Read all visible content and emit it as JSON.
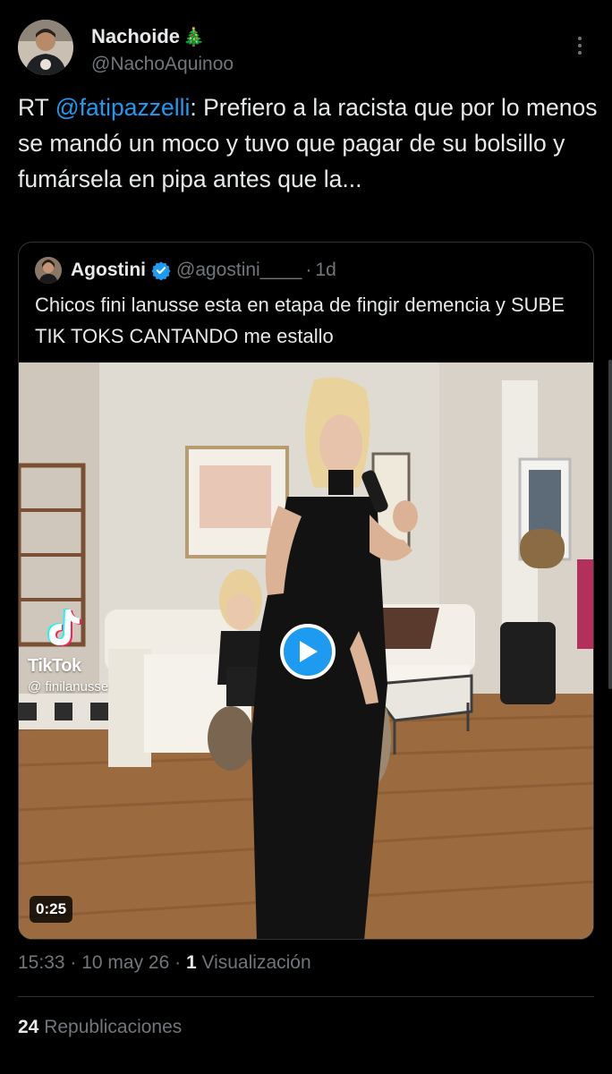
{
  "tweet": {
    "author": {
      "display_name": "Nachoide",
      "name_emoji": "🎄",
      "handle": "@NachoAquinoo"
    },
    "text_prefix": "RT ",
    "mention": "@fatipazzelli",
    "text_body": ": Prefiero a la racista que por lo menos se mandó un moco y tuvo que pagar de su bolsillo y fumársela en pipa antes que la...",
    "quoted": {
      "name": "Agostini",
      "handle": "@agostini____",
      "separator": "·",
      "time_ago": "1d",
      "text": "Chicos fini lanusse esta en etapa de fingir demencia y SUBE TIK TOKS CANTANDO me estallo",
      "video": {
        "duration": "0:25",
        "watermark_brand": "TikTok",
        "watermark_handle": "@ finilanusse"
      }
    },
    "timestamp": "15:33 · 10 may 26 · ",
    "views_count": "1",
    "views_label": " Visualización",
    "reposts_count": "24",
    "reposts_label": " Republicaciones"
  },
  "icons": {
    "more": "more-vertical-icon",
    "verified": "verified-badge-icon",
    "play": "play-icon",
    "tiktok": "tiktok-logo-icon"
  },
  "colors": {
    "background": "#000000",
    "text": "#e7e9ea",
    "muted": "#71767b",
    "accent": "#1d9bf0",
    "border": "#2f3336"
  }
}
